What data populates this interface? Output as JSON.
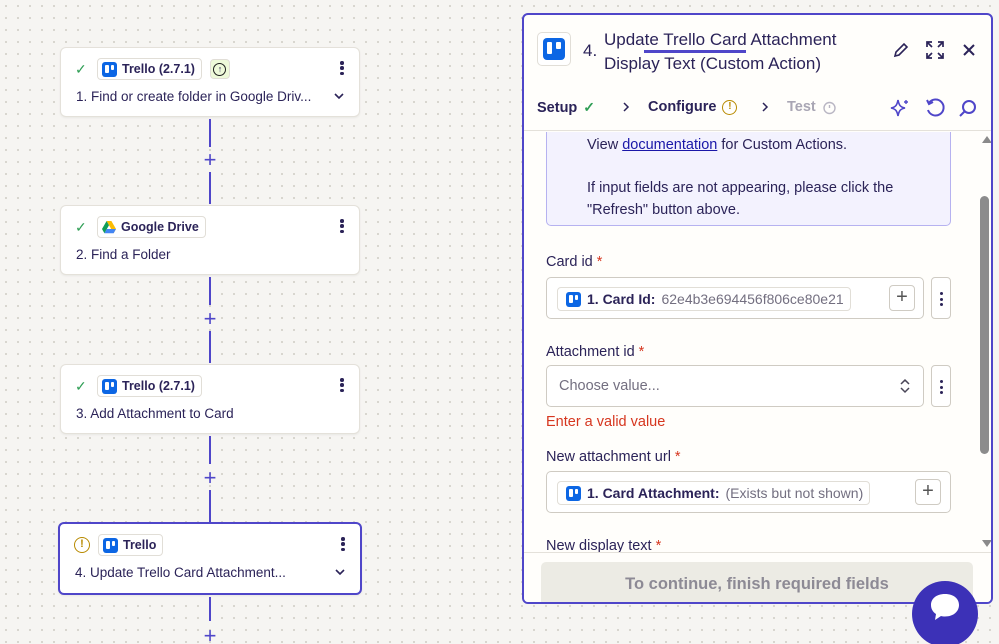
{
  "workflow": {
    "steps": [
      {
        "app": "Trello (2.7.1)",
        "title": "1. Find or create folder in Google Driv...",
        "status": "check",
        "has_bolt": true,
        "has_chevron": true
      },
      {
        "app": "Google Drive",
        "title": "2. Find a Folder",
        "status": "check",
        "has_bolt": false,
        "has_chevron": false
      },
      {
        "app": "Trello (2.7.1)",
        "title": "3. Add Attachment to Card",
        "status": "check",
        "has_bolt": false,
        "has_chevron": false
      },
      {
        "app": "Trello",
        "title": "4. Update Trello Card Attachment...",
        "status": "warning",
        "has_bolt": false,
        "has_chevron": true
      }
    ],
    "add_symbol": "+"
  },
  "panel": {
    "step_number": "4.",
    "title": "Update Trello Card Attachment Display Text (Custom Action)",
    "tabs": [
      {
        "label": "Setup",
        "state": "done"
      },
      {
        "label": "Configure",
        "state": "warning"
      },
      {
        "label": "Test",
        "state": "disabled"
      }
    ],
    "info": {
      "prefix": "View ",
      "link": "documentation",
      "suffix": " for Custom Actions.",
      "refresh_note": "If input fields are not appearing, please click the \"Refresh\" button above."
    },
    "fields": {
      "card_id": {
        "label": "Card id",
        "required": "*",
        "pill_label": "1. Card Id:",
        "pill_value": "62e4b3e694456f806ce80e21"
      },
      "attachment_id": {
        "label": "Attachment id",
        "required": "*",
        "placeholder": "Choose value...",
        "error": "Enter a valid value"
      },
      "new_attachment_url": {
        "label": "New attachment url",
        "required": "*",
        "pill_label": "1. Card Attachment:",
        "pill_value": "(Exists but not shown)"
      },
      "new_display_text": {
        "label": "New display text",
        "required": "*"
      }
    },
    "continue_button": "To continue, finish required fields"
  },
  "colors": {
    "accent": "#4f46c9",
    "trello_blue": "#0c66e4",
    "success": "#2f9e55",
    "warning": "#b88a00",
    "error": "#d6361f",
    "chat_bubble": "#3c31b7"
  },
  "icons": [
    "check-icon",
    "warning-icon",
    "trello-logo-icon",
    "google-drive-icon",
    "bolt-icon",
    "kebab-icon",
    "chevron-down-icon",
    "plus-icon",
    "pencil-icon",
    "expand-icon",
    "close-icon",
    "chevron-right-icon",
    "timer-icon",
    "sparkle-icon",
    "refresh-icon",
    "search-icon",
    "updown-icon",
    "chat-icon"
  ]
}
